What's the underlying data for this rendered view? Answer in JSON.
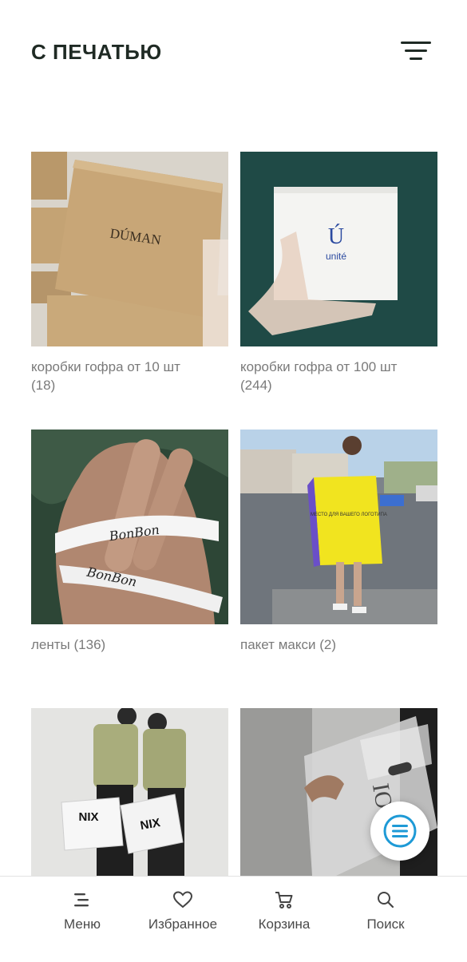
{
  "header": {
    "title": "С ПЕЧАТЬЮ",
    "filter_icon": "filter-lines-icon"
  },
  "products": [
    {
      "name": "коробки гофра от 10 шт",
      "count": "(18)",
      "image_text": "DÚMAN"
    },
    {
      "name": "коробки гофра от 100 шт",
      "count": "(244)",
      "image_text": "unité"
    },
    {
      "name": "ленты",
      "count": "(136)",
      "image_text": "BonBon"
    },
    {
      "name": "пакет макси",
      "count": "(2)",
      "image_text": "МЕСТО ДЛЯ ВАШЕГО ЛОГОТИПА"
    },
    {
      "name": "",
      "count": "",
      "image_text": "NIX"
    },
    {
      "name": "",
      "count": "",
      "image_text": "IOS"
    }
  ],
  "fab": {
    "icon": "list-menu-icon"
  },
  "bottom_nav": [
    {
      "label": "Меню",
      "icon": "menu-icon"
    },
    {
      "label": "Избранное",
      "icon": "heart-icon"
    },
    {
      "label": "Корзина",
      "icon": "cart-icon"
    },
    {
      "label": "Поиск",
      "icon": "search-icon"
    }
  ],
  "colors": {
    "title": "#1f2a24",
    "caption": "#7a7a7a",
    "fab_accent": "#1e9ad6",
    "panel_teal": "#1f4a46",
    "kraft": "#c9a97a"
  }
}
